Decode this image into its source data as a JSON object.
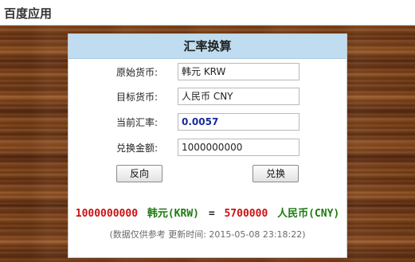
{
  "app": {
    "title": "百度应用"
  },
  "converter": {
    "title": "汇率换算",
    "source_label": "原始货币:",
    "source_value": "韩元 KRW",
    "target_label": "目标货币:",
    "target_value": "人民币 CNY",
    "rate_label": "当前汇率:",
    "rate_value": "0.0057",
    "amount_label": "兑换金额:",
    "amount_value": "1000000000",
    "reverse_label": "反向",
    "convert_label": "兑换",
    "result": {
      "source_amount": "1000000000",
      "source_currency": "韩元(KRW)",
      "equals": "=",
      "target_amount": "5700000",
      "target_currency": "人民币(CNY)"
    },
    "note": "(数据仅供参考 更新时间: 2015-05-08 23:18:22)"
  },
  "colors": {
    "header_bg": "#bfdcf0",
    "amount_color": "#cc1010",
    "currency_color": "#1d7a10",
    "rate_color": "#1a2a9c"
  }
}
